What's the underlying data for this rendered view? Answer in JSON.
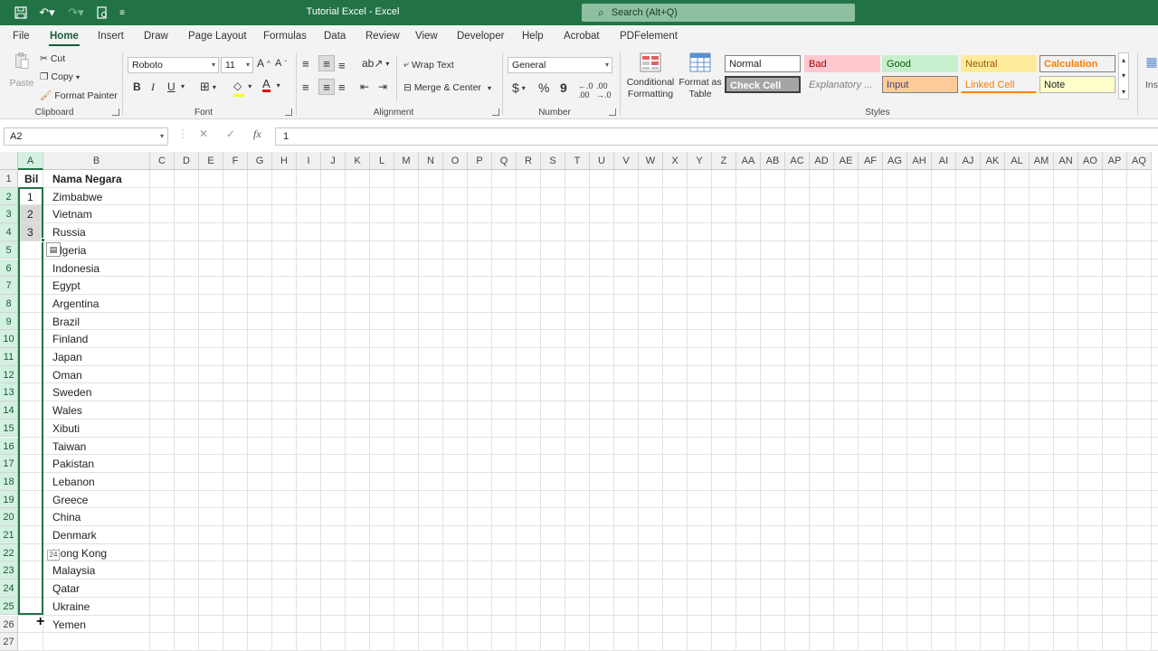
{
  "window": {
    "title": "Tutorial Excel  -  Excel",
    "search_placeholder": "Search (Alt+Q)"
  },
  "tabs": [
    {
      "label": "File"
    },
    {
      "label": "Home"
    },
    {
      "label": "Insert"
    },
    {
      "label": "Draw"
    },
    {
      "label": "Page Layout"
    },
    {
      "label": "Formulas"
    },
    {
      "label": "Data"
    },
    {
      "label": "Review"
    },
    {
      "label": "View"
    },
    {
      "label": "Developer"
    },
    {
      "label": "Help"
    },
    {
      "label": "Acrobat"
    },
    {
      "label": "PDFelement"
    }
  ],
  "ribbon": {
    "clipboard": {
      "paste": "Paste",
      "cut": "Cut",
      "copy": "Copy",
      "format_painter": "Format Painter",
      "label": "Clipboard"
    },
    "font": {
      "name": "Roboto",
      "size": "11",
      "label": "Font",
      "bold": "B",
      "italic": "I",
      "underline": "U"
    },
    "alignment": {
      "wrap_text": "Wrap Text",
      "merge_center": "Merge & Center",
      "label": "Alignment"
    },
    "number": {
      "format": "General",
      "currency": "$",
      "percent": "%",
      "comma": "9",
      "label": "Number"
    },
    "styles": {
      "conditional_formatting_1": "Conditional",
      "conditional_formatting_2": "Formatting",
      "format_as_table_1": "Format as",
      "format_as_table_2": "Table",
      "label": "Styles",
      "cells": [
        {
          "label": "Normal"
        },
        {
          "label": "Bad"
        },
        {
          "label": "Good"
        },
        {
          "label": "Neutral"
        },
        {
          "label": "Calculation"
        },
        {
          "label": "Check Cell"
        },
        {
          "label": "Explanatory ..."
        },
        {
          "label": "Input"
        },
        {
          "label": "Linked Cell"
        },
        {
          "label": "Note"
        }
      ],
      "more_cut": "Ins"
    }
  },
  "formula_bar": {
    "name_box": "A2",
    "fx": "fx",
    "value": "1"
  },
  "grid": {
    "columns": [
      "A",
      "B",
      "C",
      "D",
      "E",
      "F",
      "G",
      "H",
      "I",
      "J",
      "K",
      "L",
      "M",
      "N",
      "O",
      "P",
      "Q",
      "R",
      "S",
      "T",
      "U",
      "V",
      "W",
      "X",
      "Y",
      "Z",
      "AA",
      "AB",
      "AC",
      "AD",
      "AE",
      "AF",
      "AG",
      "AH",
      "AI",
      "AJ",
      "AK",
      "AL",
      "AM",
      "AN",
      "AO",
      "AP",
      "AQ"
    ],
    "rows": [
      "1",
      "2",
      "3",
      "4",
      "5",
      "6",
      "7",
      "8",
      "9",
      "10",
      "11",
      "12",
      "13",
      "14",
      "15",
      "16",
      "17",
      "18",
      "19",
      "20",
      "21",
      "22",
      "23",
      "24",
      "25",
      "26",
      "27"
    ],
    "headers": {
      "a1": "Bil",
      "b1": "Nama Negara"
    },
    "bil": [
      "1",
      "2",
      "3"
    ],
    "countries": [
      "Zimbabwe",
      "Vietnam",
      "Russia",
      "Algeria",
      "Indonesia",
      "Egypt",
      "Argentina",
      "Brazil",
      "Finland",
      "Japan",
      "Oman",
      "Sweden",
      "Wales",
      "Xibuti",
      "Taiwan",
      "Pakistan",
      "Lebanon",
      "Greece",
      "China",
      "Denmark",
      "Hong Kong",
      "Malaysia",
      "Qatar",
      "Ukraine",
      "Yemen"
    ],
    "fill_tooltip": "24"
  },
  "colors": {
    "brand": "#217346",
    "selection": "#185c37"
  }
}
